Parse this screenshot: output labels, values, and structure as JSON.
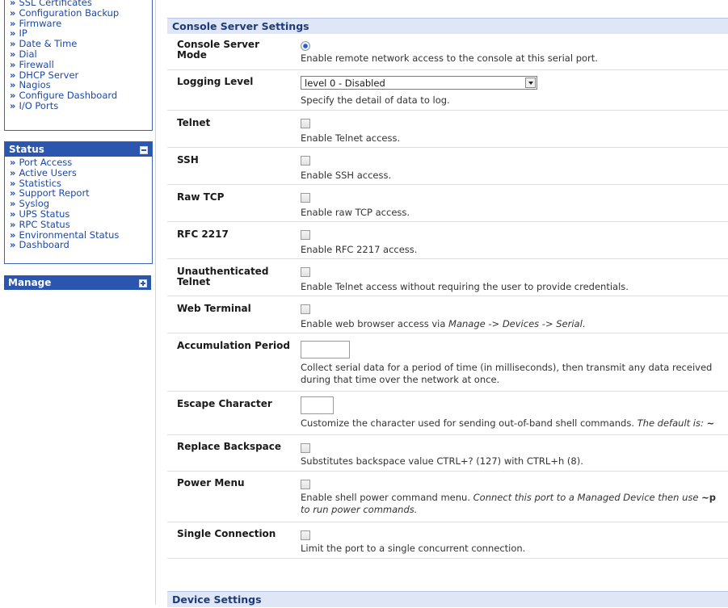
{
  "sidebar": {
    "top_items": [
      "SSL Certificates",
      "Configuration Backup",
      "Firmware",
      "IP",
      "Date & Time",
      "Dial",
      "Firewall",
      "DHCP Server",
      "Nagios",
      "Configure Dashboard",
      "I/O Ports"
    ],
    "status": {
      "title": "Status",
      "items": [
        "Port Access",
        "Active Users",
        "Statistics",
        "Support Report",
        "Syslog",
        "UPS Status",
        "RPC Status",
        "Environmental Status",
        "Dashboard"
      ]
    },
    "manage": {
      "title": "Manage"
    }
  },
  "console_settings": {
    "title": "Console Server Settings",
    "mode": {
      "label": "Console Server Mode",
      "desc": "Enable remote network access to the console at this serial port."
    },
    "logging": {
      "label": "Logging Level",
      "value": "level 0 - Disabled",
      "desc": "Specify the detail of data to log."
    },
    "telnet": {
      "label": "Telnet",
      "desc": "Enable Telnet access."
    },
    "ssh": {
      "label": "SSH",
      "desc": "Enable SSH access."
    },
    "rawtcp": {
      "label": "Raw TCP",
      "desc": "Enable raw TCP access."
    },
    "rfc2217": {
      "label": "RFC 2217",
      "desc": "Enable RFC 2217 access."
    },
    "unauth_telnet": {
      "label": "Unauthenticated Telnet",
      "desc": "Enable Telnet access without requiring the user to provide credentials."
    },
    "web_terminal": {
      "label": "Web Terminal",
      "desc_prefix": "Enable web browser access via ",
      "desc_path": "Manage -> Devices -> Serial",
      "desc_suffix": "."
    },
    "accumulation": {
      "label": "Accumulation Period",
      "value": "",
      "desc": "Collect serial data for a period of time (in milliseconds), then transmit any data received during that time over the network at once."
    },
    "escape": {
      "label": "Escape Character",
      "value": "",
      "desc": "Customize the character used for sending out-of-band shell commands. ",
      "default_text": "The default is: ",
      "default_char": "~"
    },
    "replace_backspace": {
      "label": "Replace Backspace",
      "desc": "Substitutes backspace value CTRL+? (127) with CTRL+h (8)."
    },
    "power_menu": {
      "label": "Power Menu",
      "desc": "Enable shell power command menu. ",
      "italic_a": "Connect this port to a Managed Device then use ",
      "key": "~p",
      "italic_b": " to run power commands."
    },
    "single_conn": {
      "label": "Single Connection",
      "desc": "Limit the port to a single concurrent connection."
    }
  },
  "device_settings": {
    "title": "Device Settings"
  }
}
